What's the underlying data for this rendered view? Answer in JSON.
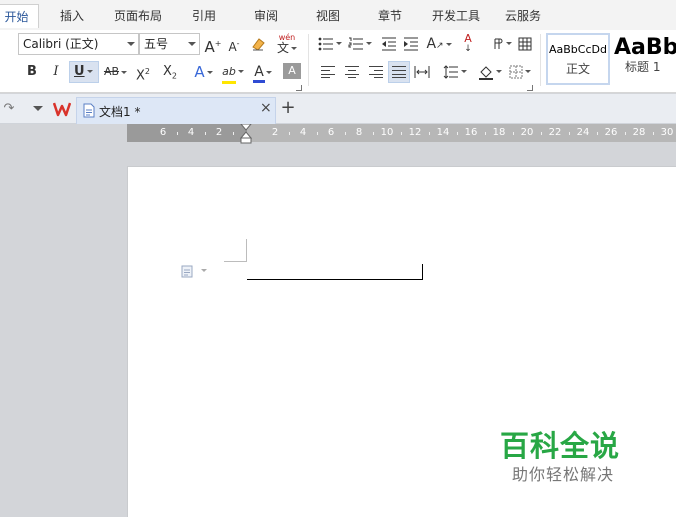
{
  "menu": {
    "tabs": [
      {
        "label": "开始",
        "active": true
      },
      {
        "label": "插入"
      },
      {
        "label": "页面布局"
      },
      {
        "label": "引用"
      },
      {
        "label": "审阅"
      },
      {
        "label": "视图"
      },
      {
        "label": "章节"
      },
      {
        "label": "开发工具"
      },
      {
        "label": "云服务"
      }
    ]
  },
  "ribbon": {
    "font_name": "Calibri (正文)",
    "font_size": "五号",
    "bold": "B",
    "italic": "I",
    "underline": "U",
    "strikethrough": "AB",
    "superscript_base": "X",
    "superscript_exp": "2",
    "subscript_base": "X",
    "subscript_sub": "2",
    "grow_font": "A",
    "shrink_font": "A",
    "phonetic_top": "wén",
    "phonetic_bottom": "文",
    "text_effect": "A",
    "font_color": "A",
    "char_shading": "A",
    "highlight": "ab",
    "para_mark": "A",
    "sort": "A",
    "styles": [
      {
        "sample": "AaBbCcDd",
        "name": "正文",
        "selected": true
      },
      {
        "sample": "AaBb",
        "name": "标题 1"
      }
    ]
  },
  "tabbar": {
    "doc_title": "文档1 *"
  },
  "ruler": {
    "labels": [
      "6",
      "4",
      "2",
      "2",
      "4",
      "6",
      "8",
      "10",
      "12",
      "14",
      "16",
      "18",
      "20",
      "22",
      "24",
      "26",
      "28",
      "30"
    ]
  },
  "watermark": {
    "brand": "百科全说",
    "slogan": "助你轻松解决"
  },
  "colors": {
    "accent": "#2b579a",
    "font_color_bar": "#2f4bd3",
    "highlight_bar": "#ffe600",
    "logo_red": "#d9332b",
    "watermark_green": "#28a745"
  }
}
